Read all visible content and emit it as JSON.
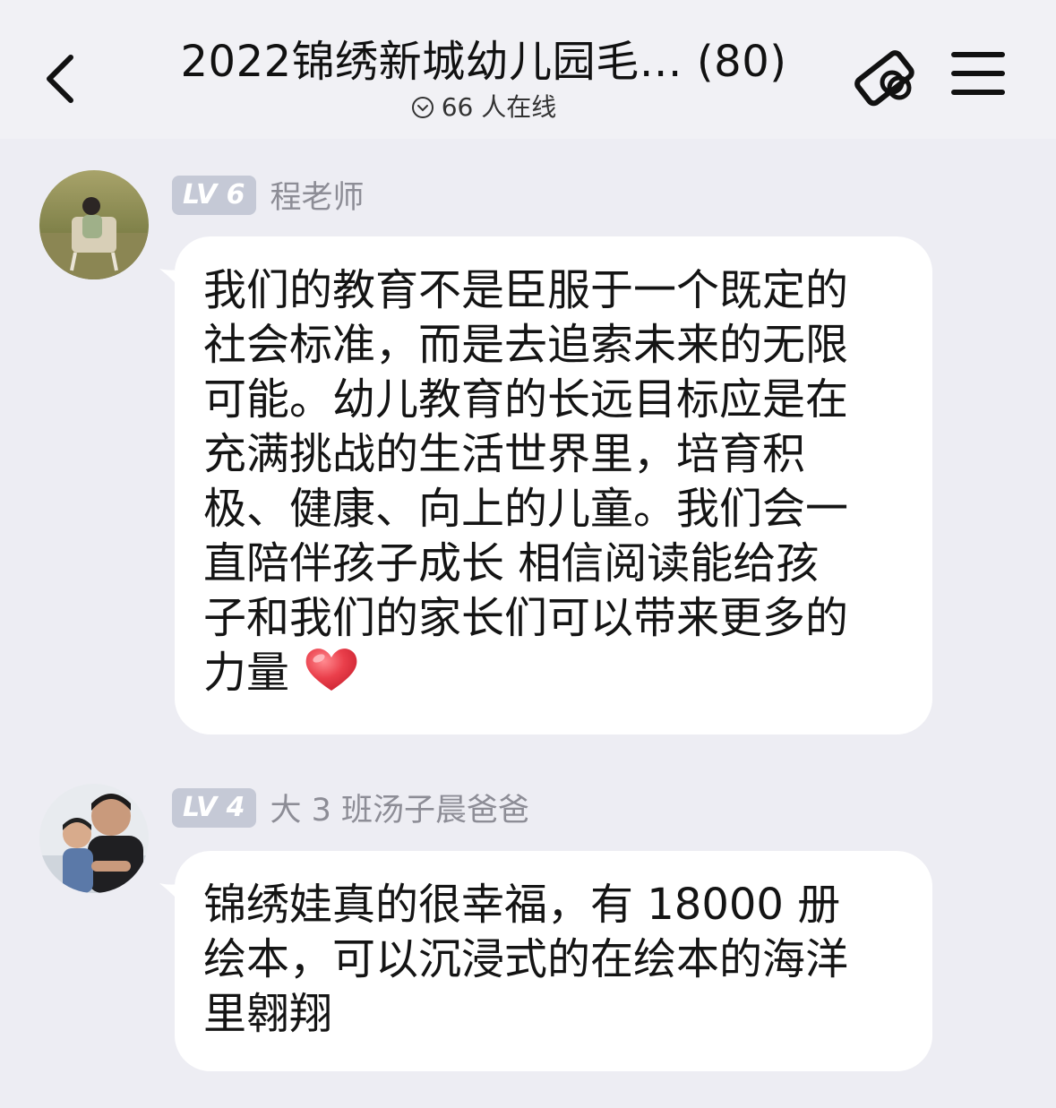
{
  "header": {
    "back_label": "<",
    "title": "2022锦绣新城幼儿园毛… (80)",
    "online": "66 人在线"
  },
  "messages": [
    {
      "level": "LV 6",
      "sender": "程老师",
      "lines": [
        "我们的教育不是臣服于一个既定的",
        "社会标准，而是去追索未来的无限",
        "可能。幼儿教育的长远目标应是在",
        "充满挑战的生活世界里，培育积",
        "极、健康、向上的儿童。我们会一",
        "直陪伴孩子成长  相信阅读能给孩",
        "子和我们的家长们可以带来更多的",
        "力量"
      ],
      "emoji": "heart-emoji"
    },
    {
      "level": "LV 4",
      "sender": "大 3 班汤子晨爸爸",
      "lines": [
        "锦绣娃真的很幸福，有 18000 册",
        "绘本，可以沉浸式的在绘本的海洋",
        "里翱翔"
      ]
    }
  ],
  "colors": {
    "background": "#ededf3",
    "bubble": "#ffffff",
    "level_badge": "#c5c9d6",
    "sender_text": "#8d8d96"
  }
}
